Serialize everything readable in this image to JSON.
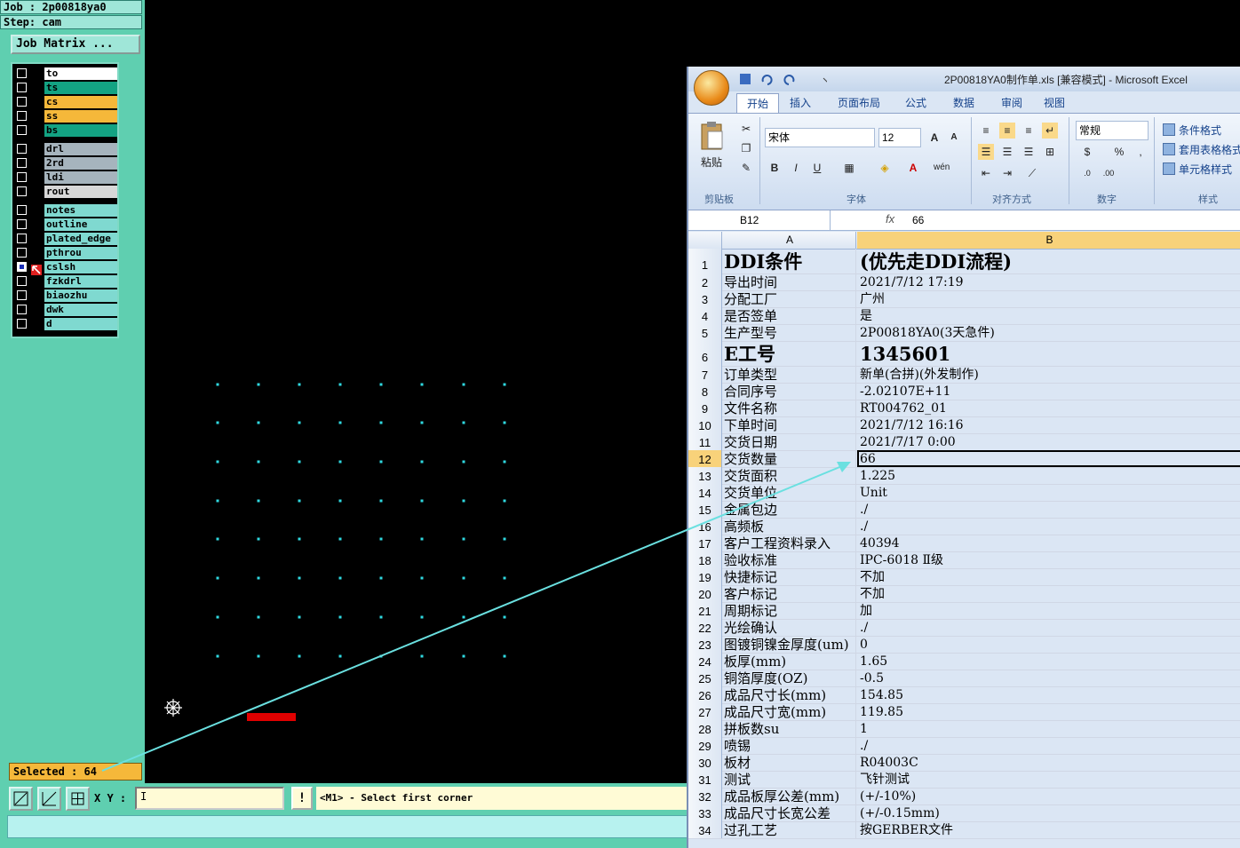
{
  "cam": {
    "job": "Job  : 2p00818ya0",
    "step": "Step: cam",
    "job_matrix": "Job Matrix ...",
    "layers": [
      {
        "name": "to",
        "color": "#ffffff",
        "checked": false
      },
      {
        "name": "ts",
        "color": "#13a383",
        "checked": false
      },
      {
        "name": "cs",
        "color": "#f5b83a",
        "checked": false
      },
      {
        "name": "ss",
        "color": "#f5b83a",
        "checked": false
      },
      {
        "name": "bs",
        "color": "#13a383",
        "checked": false
      },
      {
        "name": "drl",
        "color": "#a6b4bd",
        "checked": false
      },
      {
        "name": "2rd",
        "color": "#a6b4bd",
        "checked": false
      },
      {
        "name": "ldi",
        "color": "#a6b4bd",
        "checked": false
      },
      {
        "name": "rout",
        "color": "#d8d8d8",
        "checked": false
      },
      {
        "name": "notes",
        "color": "#7fd9d0",
        "checked": false
      },
      {
        "name": "outline",
        "color": "#7fd9d0",
        "checked": false
      },
      {
        "name": "plated_edge",
        "color": "#7fd9d0",
        "checked": false
      },
      {
        "name": "pthrou",
        "color": "#7fd9d0",
        "checked": false
      },
      {
        "name": "cslsh",
        "color": "#7fd9d0",
        "checked": true
      },
      {
        "name": "fzkdrl",
        "color": "#7fd9d0",
        "checked": false
      },
      {
        "name": "biaozhu",
        "color": "#7fd9d0",
        "checked": false
      },
      {
        "name": "dwk",
        "color": "#7fd9d0",
        "checked": false
      },
      {
        "name": "d",
        "color": "#7fd9d0",
        "checked": false
      }
    ],
    "selected": "Selected : 64",
    "xy_label": "X Y :",
    "xy_value": "I",
    "excl": "!",
    "status": "<M1> - Select first corner"
  },
  "excel": {
    "title": "2P00818YA0制作单.xls  [兼容模式] - Microsoft Excel",
    "tabs": [
      "开始",
      "插入",
      "页面布局",
      "公式",
      "数据",
      "审阅",
      "视图"
    ],
    "font_name": "宋体",
    "font_size": "12",
    "number_format": "常规",
    "paste_label": "粘贴",
    "groups": [
      "剪贴板",
      "字体",
      "对齐方式",
      "数字",
      "样式"
    ],
    "style_buttons": [
      "条件格式",
      "套用表格格式",
      "单元格样式"
    ],
    "name_box": "B12",
    "fx": "fx",
    "formula_value": "66",
    "col_a": "A",
    "col_b": "B",
    "rows": [
      {
        "n": "1",
        "a": "DDI条件",
        "b": "(优先走DDI流程)"
      },
      {
        "n": "2",
        "a": "导出时间",
        "b": "2021/7/12 17:19"
      },
      {
        "n": "3",
        "a": "分配工厂",
        "b": "广州"
      },
      {
        "n": "4",
        "a": "是否签单",
        "b": "是"
      },
      {
        "n": "5",
        "a": "生产型号",
        "b": "2P00818YA0(3天急件)"
      },
      {
        "n": "6",
        "a": "E工号",
        "b": "1345601"
      },
      {
        "n": "7",
        "a": "订单类型",
        "b": "新单(合拼)(外发制作)"
      },
      {
        "n": "8",
        "a": "合同序号",
        "b": "-2.02107E+11"
      },
      {
        "n": "9",
        "a": "文件名称",
        "b": "RT004762_01"
      },
      {
        "n": "10",
        "a": "下单时间",
        "b": "2021/7/12 16:16"
      },
      {
        "n": "11",
        "a": "交货日期",
        "b": "2021/7/17  0:00"
      },
      {
        "n": "12",
        "a": "交货数量",
        "b": "66"
      },
      {
        "n": "13",
        "a": "交货面积",
        "b": "1.225"
      },
      {
        "n": "14",
        "a": "交货单位",
        "b": "Unit"
      },
      {
        "n": "15",
        "a": "金属包边",
        "b": "./"
      },
      {
        "n": "16",
        "a": "高频板",
        "b": "./"
      },
      {
        "n": "17",
        "a": "客户工程资料录入",
        "b": "40394"
      },
      {
        "n": "18",
        "a": "验收标准",
        "b": "IPC-6018  Ⅱ级"
      },
      {
        "n": "19",
        "a": "快捷标记",
        "b": "不加"
      },
      {
        "n": "20",
        "a": "客户标记",
        "b": "不加"
      },
      {
        "n": "21",
        "a": "周期标记",
        "b": "加"
      },
      {
        "n": "22",
        "a": "光绘确认",
        "b": "./"
      },
      {
        "n": "23",
        "a": "图镀铜镍金厚度(um)",
        "b": "0"
      },
      {
        "n": "24",
        "a": "板厚(mm)",
        "b": "1.65"
      },
      {
        "n": "25",
        "a": "铜箔厚度(OZ)",
        "b": "-0.5"
      },
      {
        "n": "26",
        "a": "成品尺寸长(mm)",
        "b": "154.85"
      },
      {
        "n": "27",
        "a": "成品尺寸宽(mm)",
        "b": "119.85"
      },
      {
        "n": "28",
        "a": "拼板数su",
        "b": "1"
      },
      {
        "n": "29",
        "a": "喷锡",
        "b": "./"
      },
      {
        "n": "30",
        "a": "板材",
        "b": "R04003C"
      },
      {
        "n": "31",
        "a": "测试",
        "b": "飞针测试"
      },
      {
        "n": "32",
        "a": "成品板厚公差(mm)",
        "b": "(+/-10%)"
      },
      {
        "n": "33",
        "a": "成品尺寸长宽公差",
        "b": "(+/-0.15mm)"
      },
      {
        "n": "34",
        "a": "过孔工艺",
        "b": "按GERBER文件"
      }
    ]
  }
}
